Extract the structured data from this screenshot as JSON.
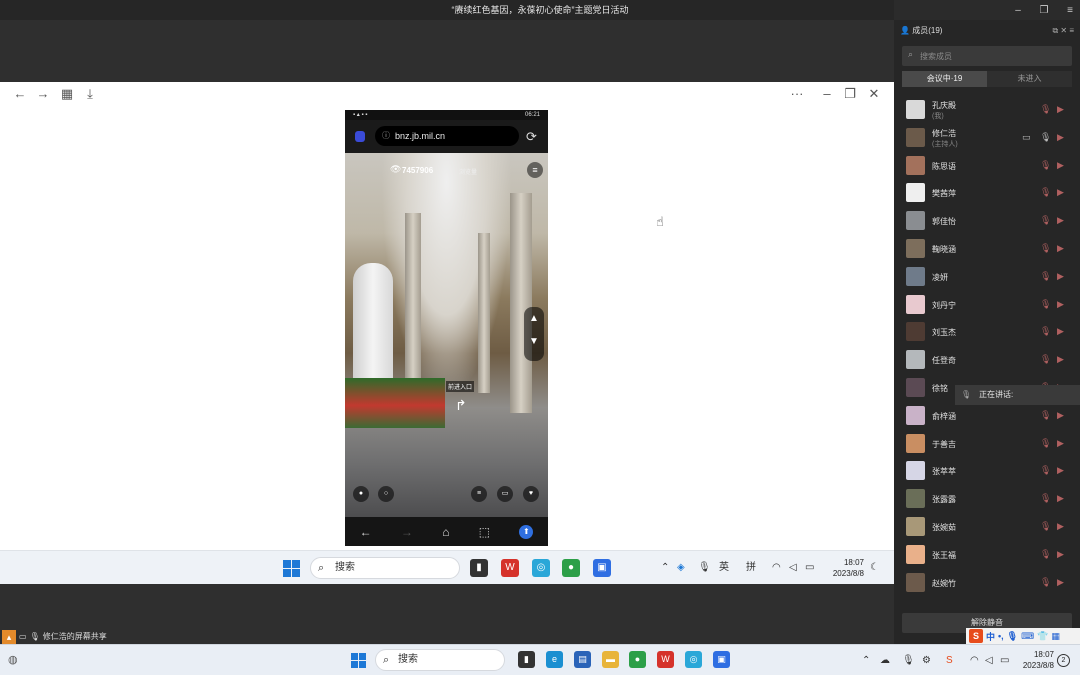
{
  "window": {
    "title": "“赓续红色基因，永葆初心使命”主题党日活动",
    "min_icon": "minimize-icon",
    "restore_icon": "restore-icon",
    "menu_icon": "menu-icon"
  },
  "share_toolbar": {
    "back": "←",
    "forward": "→",
    "grid": "▦",
    "save": "⤓",
    "more": "···",
    "min": "–",
    "restore": "❐",
    "close": "✕"
  },
  "phone": {
    "status_time": "06:21",
    "status_left": "▪ ▴ ▪ ▪",
    "url": "bnz.jb.mil.cn",
    "visits": "7457906",
    "visits_label": "浏览量",
    "sign": "前进入口",
    "nav": {
      "back": "←",
      "forward": "→",
      "home": "⌂",
      "tabs": "⬚",
      "up": "⬆"
    }
  },
  "remote_taskbar": {
    "search_placeholder": "搜索",
    "ime_lang": "英",
    "ime_mode": "拼",
    "time": "18:07",
    "date": "2023/8/8"
  },
  "share_label": "修仁浩的屏幕共享",
  "panel": {
    "title": "成员(19)",
    "search_placeholder": "搜索成员",
    "tab_in_meeting": "会议中·19",
    "tab_not_joined": "未进入",
    "speaking_label": "正在讲话:",
    "unmute_button": "解除静音",
    "members": [
      {
        "name": "孔庆殿",
        "sub": "(我)",
        "color": "#d9d9d9"
      },
      {
        "name": "修仁浩",
        "sub": "(主持人)",
        "color": "#6b5a4a",
        "sharing": true
      },
      {
        "name": "陈思语",
        "sub": "",
        "color": "#a3715c"
      },
      {
        "name": "樊茜萍",
        "sub": "",
        "color": "#efefef"
      },
      {
        "name": "郭佳怡",
        "sub": "",
        "color": "#8a8d91"
      },
      {
        "name": "鞠晓涵",
        "sub": "",
        "color": "#7d6e5c"
      },
      {
        "name": "凌妍",
        "sub": "",
        "color": "#6f7b8a"
      },
      {
        "name": "刘丹宁",
        "sub": "",
        "color": "#e8c9cf"
      },
      {
        "name": "刘玉杰",
        "sub": "",
        "color": "#4e3b33"
      },
      {
        "name": "任登奇",
        "sub": "",
        "color": "#b4b8bb"
      },
      {
        "name": "徐铭",
        "sub": "",
        "color": "#5b4a54"
      },
      {
        "name": "俞梓涵",
        "sub": "",
        "color": "#c9b2c8"
      },
      {
        "name": "于善吉",
        "sub": "",
        "color": "#c98e62"
      },
      {
        "name": "张萃萃",
        "sub": "",
        "color": "#d6d6e6"
      },
      {
        "name": "张露露",
        "sub": "",
        "color": "#6a6e58"
      },
      {
        "name": "张婉茹",
        "sub": "",
        "color": "#a89878"
      },
      {
        "name": "张王福",
        "sub": "",
        "color": "#e9b08a"
      },
      {
        "name": "赵婉竹",
        "sub": "",
        "color": "#6c5a4b"
      }
    ]
  },
  "local_taskbar": {
    "search_placeholder": "搜索",
    "time": "18:07",
    "date": "2023/8/8",
    "notif": "2"
  },
  "ime_bar": {
    "logo": "S",
    "lang": "中"
  }
}
